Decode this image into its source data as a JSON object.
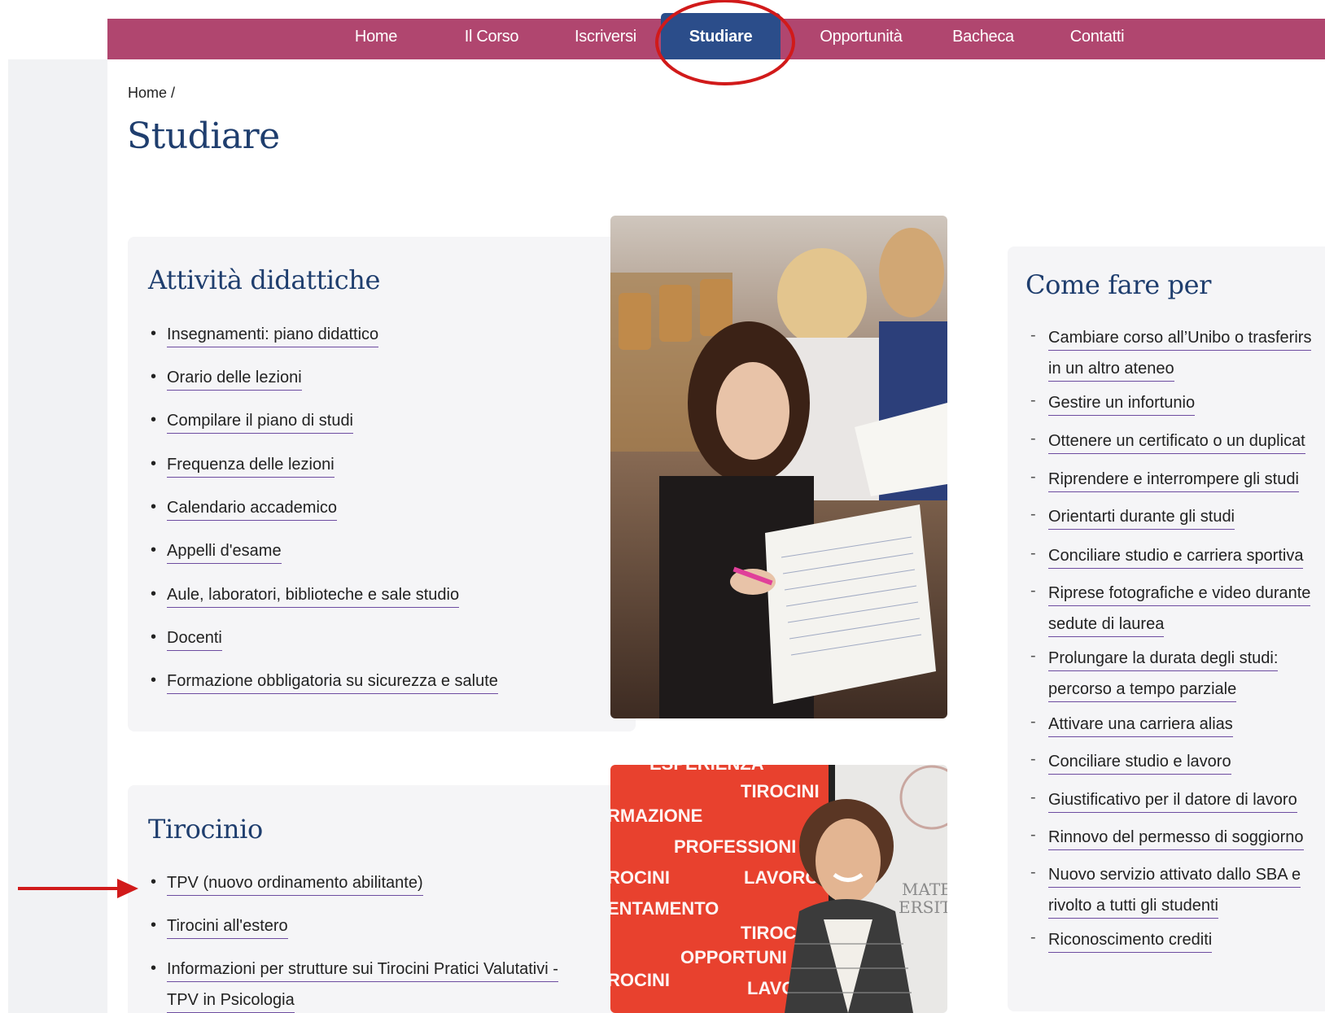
{
  "nav": {
    "items": [
      {
        "label": "Home",
        "active": false
      },
      {
        "label": "Il Corso",
        "active": false
      },
      {
        "label": "Iscriversi",
        "active": false
      },
      {
        "label": "Studiare",
        "active": true
      },
      {
        "label": "Opportunità",
        "active": false
      },
      {
        "label": "Bacheca",
        "active": false
      },
      {
        "label": "Contatti",
        "active": false
      }
    ],
    "bar_color": "#b0466f",
    "active_color": "#2b4d8a"
  },
  "breadcrumb": {
    "home": "Home",
    "separator": "/"
  },
  "page_title": "Studiare",
  "attivita": {
    "title": "Attività didattiche",
    "items": [
      "Insegnamenti: piano didattico",
      "Orario delle lezioni",
      "Compilare il piano di studi",
      "Frequenza delle lezioni",
      "Calendario accademico",
      "Appelli d'esame",
      "Aule, laboratori, biblioteche e sale studio",
      "Docenti",
      "Formazione obbligatoria su sicurezza e salute"
    ]
  },
  "tirocinio": {
    "title": "Tirocinio",
    "items": [
      "TPV (nuovo ordinamento abilitante)",
      "Tirocini all'estero",
      "Informazioni per strutture sui Tirocini Pratici Valutativi -",
      "TPV in Psicologia"
    ]
  },
  "come_fare": {
    "title": "Come fare per",
    "items": [
      "Cambiare corso all’Unibo o trasferirs",
      "in un altro ateneo",
      "Gestire un infortunio",
      "Ottenere un certificato o un duplicat",
      "Riprendere e interrompere gli studi",
      "Orientarti durante gli studi",
      "Conciliare studio e carriera sportiva",
      "Riprese fotografiche e video durante",
      "sedute di laurea",
      "Prolungare la durata degli studi:",
      "percorso a tempo parziale",
      "Attivare una carriera alias",
      "Conciliare studio e lavoro",
      "Giustificativo per il datore di lavoro",
      "Rinnovo del permesso di soggiorno",
      "Nuovo servizio attivato dallo SBA e",
      "rivolto a tutti gli studenti",
      "Riconoscimento crediti"
    ]
  },
  "photo_tirocini_words": [
    "ESPERIENZA",
    "TIROCINI",
    "RMAZIONE",
    "PROFESSIONI",
    "ROCINI",
    "LAVORO",
    "ENTAMENTO",
    "TIROC",
    "OPPORTUNI",
    "ROCINI",
    "LAVO",
    "MATEI",
    "ERSITA"
  ],
  "annotation_color": "#d11a1a"
}
